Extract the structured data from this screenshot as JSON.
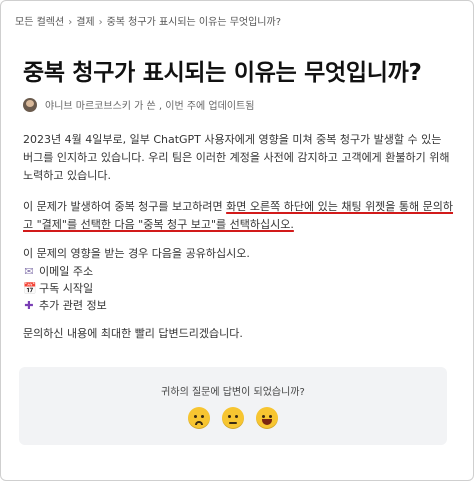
{
  "breadcrumb": [
    "모든 컬렉션",
    "결제",
    "중복 청구가 표시되는 이유는 무엇입니까?"
  ],
  "title": "중복 청구가 표시되는 이유는 무엇입니까?",
  "author": {
    "text": "야니브 마르코브스키 가 쓴 , 이번 주에 업데이트됨"
  },
  "body": {
    "p1": "2023년 4월 4일부로, 일부 ChatGPT 사용자에게 영향을 미쳐 중복 청구가 발생할 수 있는 버그를 인지하고 있습니다. 우리 팀은 이러한 계정을 사전에 감지하고 고객에게 환불하기 위해 노력하고 있습니다.",
    "p2_start": "이 문제가 발생하여 중복 청구를 보고하려면 ",
    "p2_underlined": "화면 오른쪽 하단에 있는 채팅 위젯을 통해 문의하고 \"결제\"를 선택한 다음 \"중복 청구 보고\"를 선택하십시오.",
    "p3": "이 문제의 영향을 받는 경우 다음을 공유하십시오.",
    "list": [
      {
        "icon": "mail-icon",
        "glyph": "✉",
        "label": "이메일 주소"
      },
      {
        "icon": "calendar-icon",
        "glyph": "📅",
        "label": "구독 시작일"
      },
      {
        "icon": "plus-icon",
        "glyph": "✚",
        "label": "추가 관련 정보"
      }
    ],
    "p4": "문의하신 내용에 최대한 빨리 답변드리겠습니다."
  },
  "feedback": {
    "question": "귀하의 질문에 답변이 되었습니까?",
    "reactions": [
      "sad",
      "neutral",
      "happy"
    ]
  },
  "colors": {
    "underline": "#d21a1a",
    "feedback_bg": "#f2f3f5",
    "emoji": "#f7c531"
  }
}
